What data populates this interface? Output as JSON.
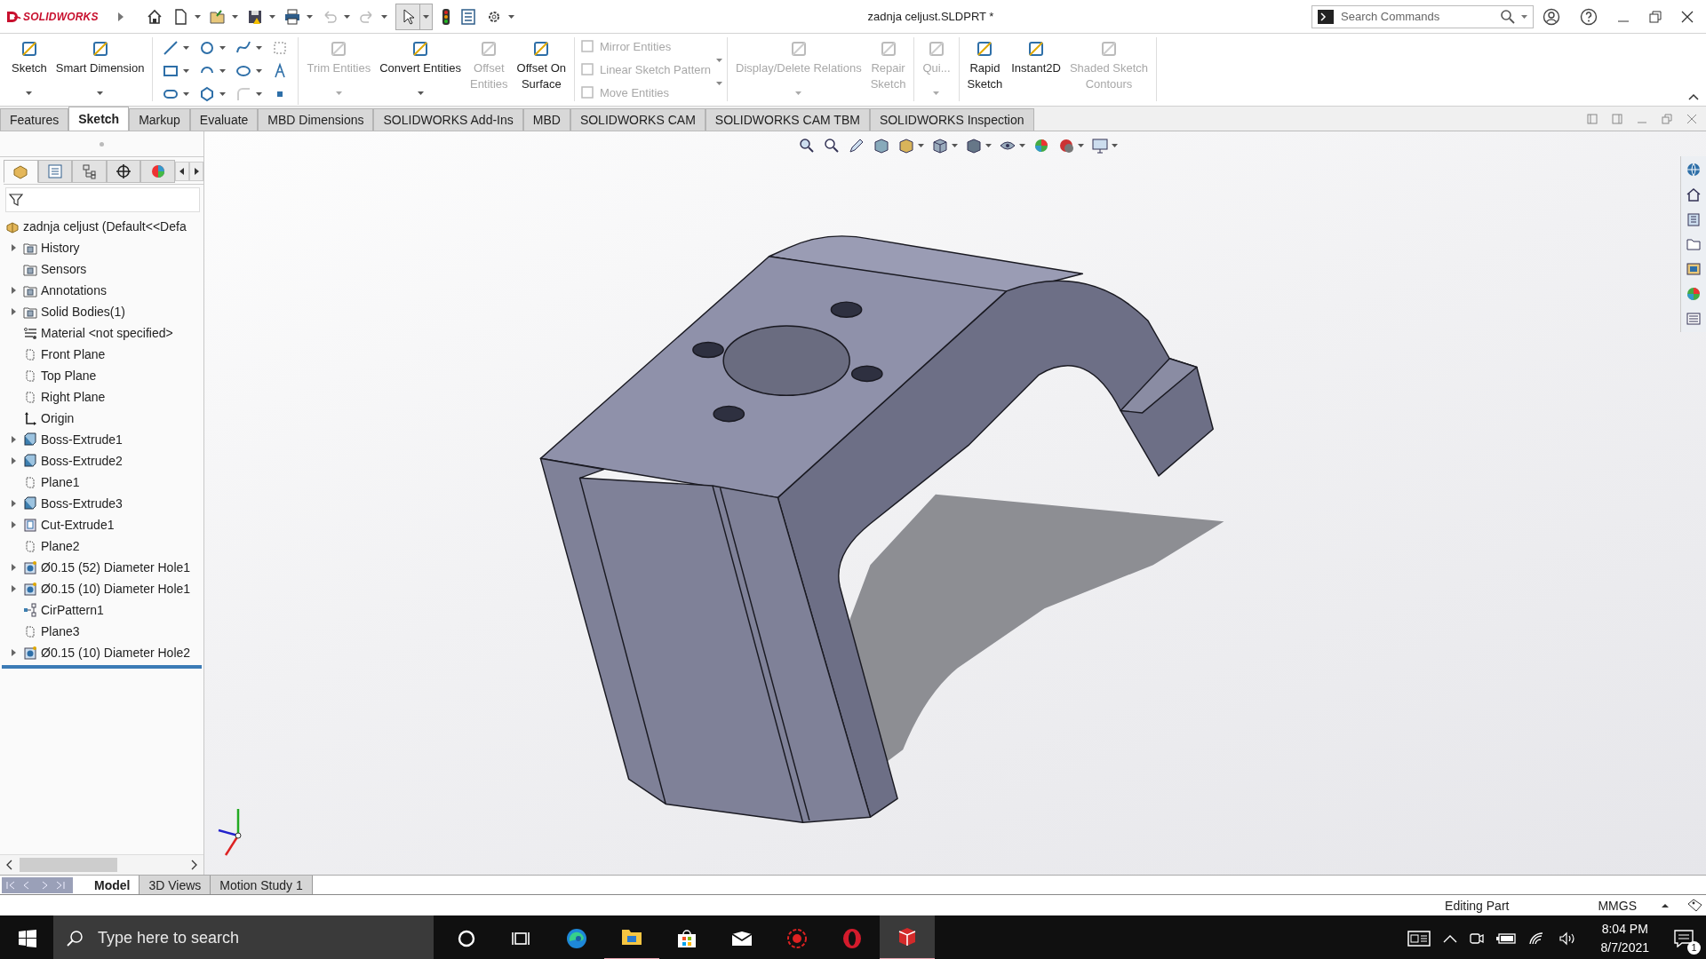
{
  "titlebar": {
    "logo": "SOLIDWORKS",
    "document_title": "zadnja celjust.SLDPRT *",
    "search": {
      "placeholder": "Search Commands"
    }
  },
  "ribbon": {
    "groups": [
      {
        "kind": "large",
        "items": [
          {
            "label": "Sketch",
            "disabled": false,
            "dropdown": true
          },
          {
            "label": "Smart Dimension",
            "disabled": false,
            "dropdown": true
          }
        ]
      },
      {
        "kind": "grid"
      },
      {
        "kind": "large",
        "items": [
          {
            "label": "Trim Entities",
            "disabled": true,
            "dropdown": true
          },
          {
            "label": "Convert Entities",
            "disabled": false,
            "dropdown": true
          },
          {
            "label": "Offset\nEntities",
            "disabled": true,
            "dropdown": false
          },
          {
            "label": "Offset On\nSurface",
            "disabled": false,
            "dropdown": false
          }
        ]
      },
      {
        "kind": "stack",
        "items": [
          {
            "label": "Mirror Entities",
            "disabled": true
          },
          {
            "label": "Linear Sketch Pattern",
            "disabled": true
          },
          {
            "label": "Move Entities",
            "disabled": true
          }
        ]
      },
      {
        "kind": "large",
        "items": [
          {
            "label": "Display/Delete Relations",
            "disabled": true,
            "dropdown": true
          },
          {
            "label": "Repair\nSketch",
            "disabled": true,
            "dropdown": false
          }
        ]
      },
      {
        "kind": "large",
        "items": [
          {
            "label": "Qui...",
            "disabled": true,
            "dropdown": true
          }
        ]
      },
      {
        "kind": "large",
        "items": [
          {
            "label": "Rapid\nSketch",
            "disabled": false,
            "dropdown": false
          },
          {
            "label": "Instant2D",
            "disabled": false,
            "dropdown": false
          },
          {
            "label": "Shaded Sketch\nContours",
            "disabled": true,
            "dropdown": false
          }
        ]
      }
    ]
  },
  "tabs": [
    {
      "label": "Features",
      "selected": false
    },
    {
      "label": "Sketch",
      "selected": true
    },
    {
      "label": "Markup",
      "selected": false
    },
    {
      "label": "Evaluate",
      "selected": false
    },
    {
      "label": "MBD Dimensions",
      "selected": false
    },
    {
      "label": "SOLIDWORKS Add-Ins",
      "selected": false
    },
    {
      "label": "MBD",
      "selected": false
    },
    {
      "label": "SOLIDWORKS CAM",
      "selected": false
    },
    {
      "label": "SOLIDWORKS CAM TBM",
      "selected": false
    },
    {
      "label": "SOLIDWORKS Inspection",
      "selected": false
    }
  ],
  "panel_tabs": [
    {
      "selected": true
    },
    {
      "selected": false
    },
    {
      "selected": false
    },
    {
      "selected": false
    },
    {
      "selected": false
    }
  ],
  "feature_tree": {
    "root": {
      "label": "zadnja celjust  (Default<<Defa",
      "kind": "part"
    },
    "items": [
      {
        "label": "History",
        "kind": "folder",
        "expandable": true
      },
      {
        "label": "Sensors",
        "kind": "folder",
        "expandable": false
      },
      {
        "label": "Annotations",
        "kind": "folder",
        "expandable": true
      },
      {
        "label": "Solid Bodies(1)",
        "kind": "folder",
        "expandable": true
      },
      {
        "label": "Material <not specified>",
        "kind": "material",
        "expandable": false
      },
      {
        "label": "Front Plane",
        "kind": "plane",
        "expandable": false
      },
      {
        "label": "Top Plane",
        "kind": "plane",
        "expandable": false
      },
      {
        "label": "Right Plane",
        "kind": "plane",
        "expandable": false
      },
      {
        "label": "Origin",
        "kind": "origin",
        "expandable": false
      },
      {
        "label": "Boss-Extrude1",
        "kind": "feature",
        "expandable": true
      },
      {
        "label": "Boss-Extrude2",
        "kind": "feature",
        "expandable": true
      },
      {
        "label": "Plane1",
        "kind": "plane",
        "expandable": false
      },
      {
        "label": "Boss-Extrude3",
        "kind": "feature",
        "expandable": true
      },
      {
        "label": "Cut-Extrude1",
        "kind": "cut",
        "expandable": true
      },
      {
        "label": "Plane2",
        "kind": "plane",
        "expandable": false
      },
      {
        "label": "Ø0.15 (52) Diameter Hole1",
        "kind": "hole",
        "expandable": true
      },
      {
        "label": "Ø0.15 (10) Diameter Hole1",
        "kind": "hole",
        "expandable": true
      },
      {
        "label": "CirPattern1",
        "kind": "pattern",
        "expandable": false
      },
      {
        "label": "Plane3",
        "kind": "plane",
        "expandable": false
      },
      {
        "label": "Ø0.15 (10) Diameter Hole2",
        "kind": "hole",
        "expandable": true
      }
    ]
  },
  "bottom_tabs": [
    {
      "label": "Model",
      "selected": true
    },
    {
      "label": "3D Views",
      "selected": false
    },
    {
      "label": "Motion Study 1",
      "selected": false
    }
  ],
  "status_bar": {
    "mode": "Editing Part",
    "units": "MMGS"
  },
  "taskbar": {
    "search": {
      "placeholder": "Type here to search"
    },
    "apps": [
      {
        "kind": "cortana",
        "running": false,
        "active": false
      },
      {
        "kind": "taskview",
        "running": false,
        "active": false
      },
      {
        "kind": "edge",
        "running": false,
        "active": false
      },
      {
        "kind": "explorer",
        "running": true,
        "active": false
      },
      {
        "kind": "store",
        "running": false,
        "active": false
      },
      {
        "kind": "mail",
        "running": false,
        "active": false
      },
      {
        "kind": "gear",
        "running": false,
        "active": false
      },
      {
        "kind": "opera",
        "running": false,
        "active": false
      },
      {
        "kind": "solidworks",
        "running": true,
        "active": true
      }
    ],
    "time": "8:04 PM",
    "date": "8/7/2021",
    "notifications": "1"
  }
}
